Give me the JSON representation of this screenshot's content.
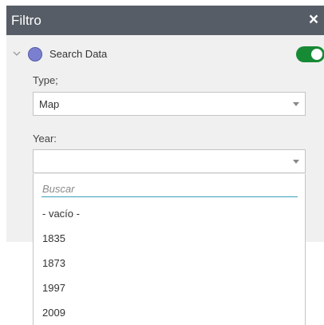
{
  "panel": {
    "title": "Filtro",
    "close_symbol": "×"
  },
  "layer": {
    "label": "Search Data",
    "dot_color": "#7b7fcf",
    "toggle_on": true,
    "toggle_color": "#168a34",
    "expand_icon": "chevron-down-icon"
  },
  "type_field": {
    "label": "Type;",
    "value": "Map"
  },
  "year_field": {
    "label": "Year:",
    "value": ""
  },
  "dropdown": {
    "search_placeholder": "Buscar",
    "options": [
      "- vacío -",
      "1835",
      "1873",
      "1997",
      "2009"
    ]
  },
  "colors": {
    "header_bg": "#575d66",
    "panel_bg": "#f0f0f0",
    "search_underline": "#3aa0b8"
  }
}
